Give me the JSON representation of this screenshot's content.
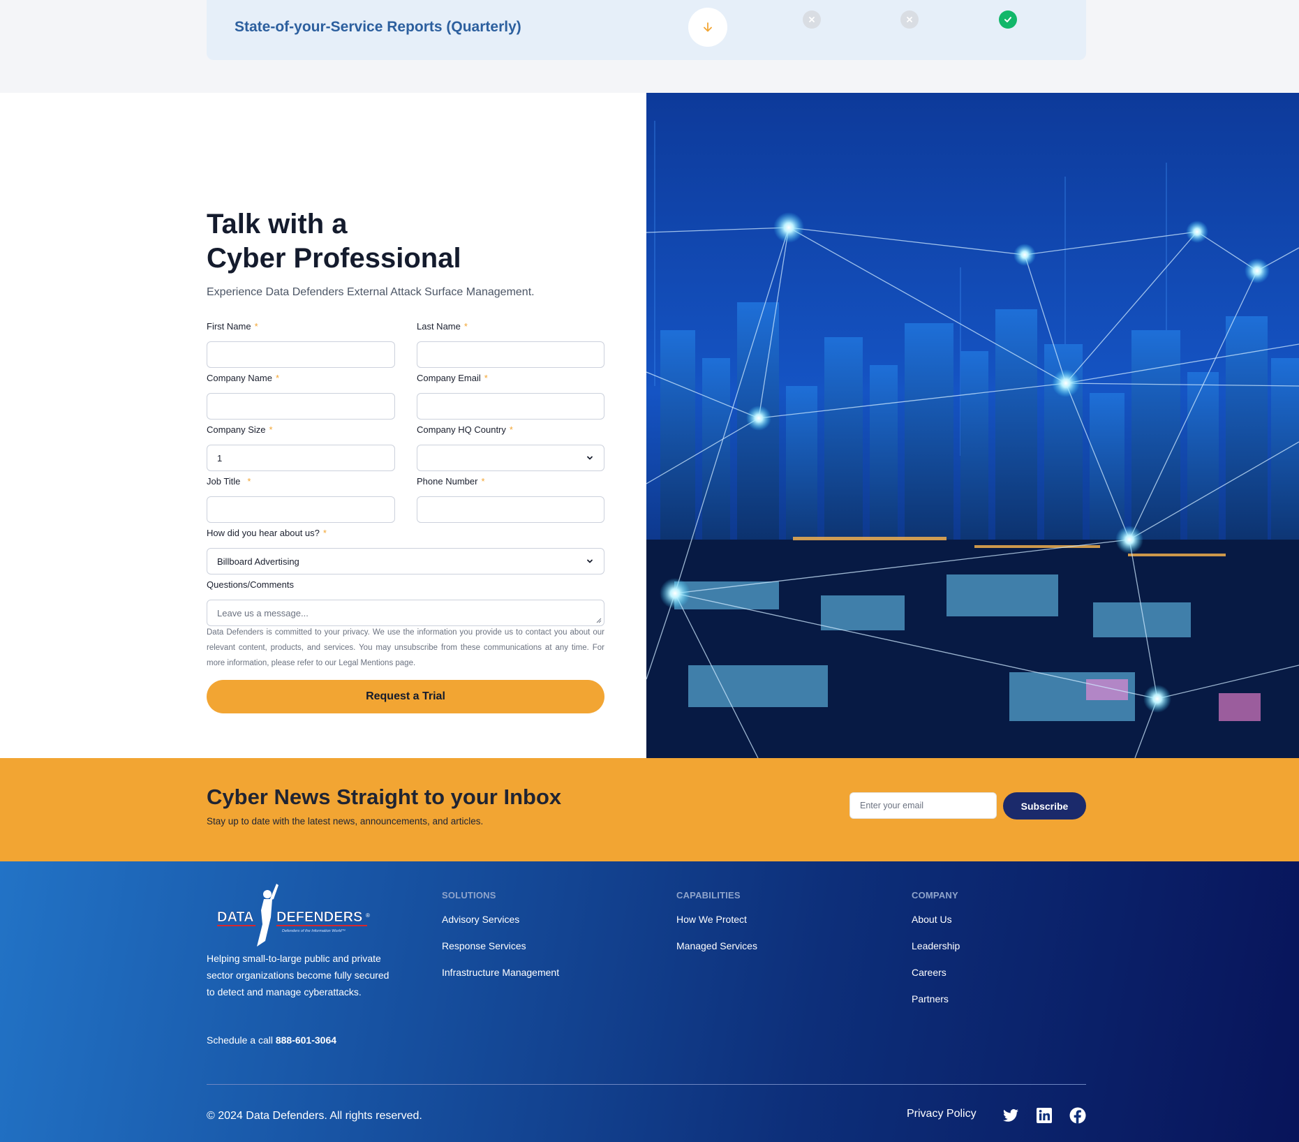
{
  "comparison_row": {
    "title": "State-of-your-Service Reports (Quarterly)",
    "download_icon": "arrow-down-icon",
    "cells": [
      "x-icon",
      "x-icon",
      "check-icon"
    ],
    "colors": {
      "x": "#d9dde3",
      "check": "#12b76a",
      "arrow": "#f2a533"
    }
  },
  "contact": {
    "heading_line1": "Talk with a",
    "heading_line2": "Cyber Professional",
    "subheading": "Experience Data Defenders External Attack Surface Management.",
    "required_marker": "*",
    "fields": {
      "first_name": {
        "label": "First Name",
        "value": ""
      },
      "last_name": {
        "label": "Last Name",
        "value": ""
      },
      "company_name": {
        "label": "Company Name",
        "value": ""
      },
      "company_email": {
        "label": "Company Email",
        "value": ""
      },
      "company_size": {
        "label": "Company Size",
        "value": "1"
      },
      "company_hq_country": {
        "label": "Company HQ Country",
        "value": ""
      },
      "job_title": {
        "label": "Job Title",
        "value": ""
      },
      "phone_number": {
        "label": "Phone Number",
        "value": ""
      },
      "hear_about": {
        "label": "How did you hear about us?",
        "value": "Billboard Advertising"
      },
      "comments": {
        "label": "Questions/Comments",
        "placeholder": "Leave us a message..."
      }
    },
    "privacy_text": "Data Defenders is committed to your privacy. We use the information you provide us to contact you about our relevant content, products, and services. You may unsubscribe from these communications at any time. For more information, please refer to our Legal Mentions page.",
    "submit_label": "Request a Trial",
    "accent_color": "#f2a533"
  },
  "newsletter": {
    "title": "Cyber News Straight to your Inbox",
    "subtitle": "Stay up to date with the latest news, announcements, and articles.",
    "email_placeholder": "Enter your email",
    "subscribe_label": "Subscribe",
    "button_color": "#1b2a6b"
  },
  "footer": {
    "logo_text_left": "DATA",
    "logo_text_right": "DEFENDERS",
    "logo_registered": "®",
    "logo_tagline": "Defenders of the Information World™",
    "tagline": "Helping small-to-large public and private sector organizations become fully secured to detect and manage cyberattacks.",
    "schedule_label": "Schedule a call",
    "phone": "888-601-3064",
    "columns": [
      {
        "heading": "SOLUTIONS",
        "links": [
          "Advisory Services",
          "Response Services",
          "Infrastructure Management"
        ]
      },
      {
        "heading": "CAPABILITIES",
        "links": [
          "How We Protect",
          "Managed Services"
        ]
      },
      {
        "heading": "COMPANY",
        "links": [
          "About Us",
          "Leadership",
          "Careers",
          "Partners"
        ]
      }
    ],
    "copyright": "© 2024 Data Defenders. All rights reserved.",
    "privacy_policy": "Privacy Policy",
    "social_icons": [
      "twitter-icon",
      "linkedin-icon",
      "facebook-icon"
    ]
  }
}
